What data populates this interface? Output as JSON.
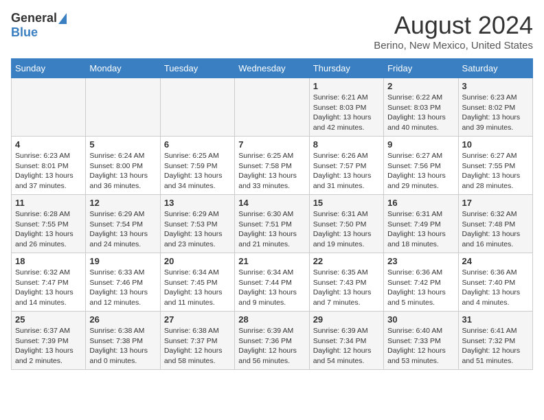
{
  "header": {
    "logo_general": "General",
    "logo_blue": "Blue",
    "month_year": "August 2024",
    "location": "Berino, New Mexico, United States"
  },
  "calendar": {
    "days_of_week": [
      "Sunday",
      "Monday",
      "Tuesday",
      "Wednesday",
      "Thursday",
      "Friday",
      "Saturday"
    ],
    "weeks": [
      [
        {
          "day": "",
          "info": ""
        },
        {
          "day": "",
          "info": ""
        },
        {
          "day": "",
          "info": ""
        },
        {
          "day": "",
          "info": ""
        },
        {
          "day": "1",
          "info": "Sunrise: 6:21 AM\nSunset: 8:03 PM\nDaylight: 13 hours\nand 42 minutes."
        },
        {
          "day": "2",
          "info": "Sunrise: 6:22 AM\nSunset: 8:03 PM\nDaylight: 13 hours\nand 40 minutes."
        },
        {
          "day": "3",
          "info": "Sunrise: 6:23 AM\nSunset: 8:02 PM\nDaylight: 13 hours\nand 39 minutes."
        }
      ],
      [
        {
          "day": "4",
          "info": "Sunrise: 6:23 AM\nSunset: 8:01 PM\nDaylight: 13 hours\nand 37 minutes."
        },
        {
          "day": "5",
          "info": "Sunrise: 6:24 AM\nSunset: 8:00 PM\nDaylight: 13 hours\nand 36 minutes."
        },
        {
          "day": "6",
          "info": "Sunrise: 6:25 AM\nSunset: 7:59 PM\nDaylight: 13 hours\nand 34 minutes."
        },
        {
          "day": "7",
          "info": "Sunrise: 6:25 AM\nSunset: 7:58 PM\nDaylight: 13 hours\nand 33 minutes."
        },
        {
          "day": "8",
          "info": "Sunrise: 6:26 AM\nSunset: 7:57 PM\nDaylight: 13 hours\nand 31 minutes."
        },
        {
          "day": "9",
          "info": "Sunrise: 6:27 AM\nSunset: 7:56 PM\nDaylight: 13 hours\nand 29 minutes."
        },
        {
          "day": "10",
          "info": "Sunrise: 6:27 AM\nSunset: 7:55 PM\nDaylight: 13 hours\nand 28 minutes."
        }
      ],
      [
        {
          "day": "11",
          "info": "Sunrise: 6:28 AM\nSunset: 7:55 PM\nDaylight: 13 hours\nand 26 minutes."
        },
        {
          "day": "12",
          "info": "Sunrise: 6:29 AM\nSunset: 7:54 PM\nDaylight: 13 hours\nand 24 minutes."
        },
        {
          "day": "13",
          "info": "Sunrise: 6:29 AM\nSunset: 7:53 PM\nDaylight: 13 hours\nand 23 minutes."
        },
        {
          "day": "14",
          "info": "Sunrise: 6:30 AM\nSunset: 7:51 PM\nDaylight: 13 hours\nand 21 minutes."
        },
        {
          "day": "15",
          "info": "Sunrise: 6:31 AM\nSunset: 7:50 PM\nDaylight: 13 hours\nand 19 minutes."
        },
        {
          "day": "16",
          "info": "Sunrise: 6:31 AM\nSunset: 7:49 PM\nDaylight: 13 hours\nand 18 minutes."
        },
        {
          "day": "17",
          "info": "Sunrise: 6:32 AM\nSunset: 7:48 PM\nDaylight: 13 hours\nand 16 minutes."
        }
      ],
      [
        {
          "day": "18",
          "info": "Sunrise: 6:32 AM\nSunset: 7:47 PM\nDaylight: 13 hours\nand 14 minutes."
        },
        {
          "day": "19",
          "info": "Sunrise: 6:33 AM\nSunset: 7:46 PM\nDaylight: 13 hours\nand 12 minutes."
        },
        {
          "day": "20",
          "info": "Sunrise: 6:34 AM\nSunset: 7:45 PM\nDaylight: 13 hours\nand 11 minutes."
        },
        {
          "day": "21",
          "info": "Sunrise: 6:34 AM\nSunset: 7:44 PM\nDaylight: 13 hours\nand 9 minutes."
        },
        {
          "day": "22",
          "info": "Sunrise: 6:35 AM\nSunset: 7:43 PM\nDaylight: 13 hours\nand 7 minutes."
        },
        {
          "day": "23",
          "info": "Sunrise: 6:36 AM\nSunset: 7:42 PM\nDaylight: 13 hours\nand 5 minutes."
        },
        {
          "day": "24",
          "info": "Sunrise: 6:36 AM\nSunset: 7:40 PM\nDaylight: 13 hours\nand 4 minutes."
        }
      ],
      [
        {
          "day": "25",
          "info": "Sunrise: 6:37 AM\nSunset: 7:39 PM\nDaylight: 13 hours\nand 2 minutes."
        },
        {
          "day": "26",
          "info": "Sunrise: 6:38 AM\nSunset: 7:38 PM\nDaylight: 13 hours\nand 0 minutes."
        },
        {
          "day": "27",
          "info": "Sunrise: 6:38 AM\nSunset: 7:37 PM\nDaylight: 12 hours\nand 58 minutes."
        },
        {
          "day": "28",
          "info": "Sunrise: 6:39 AM\nSunset: 7:36 PM\nDaylight: 12 hours\nand 56 minutes."
        },
        {
          "day": "29",
          "info": "Sunrise: 6:39 AM\nSunset: 7:34 PM\nDaylight: 12 hours\nand 54 minutes."
        },
        {
          "day": "30",
          "info": "Sunrise: 6:40 AM\nSunset: 7:33 PM\nDaylight: 12 hours\nand 53 minutes."
        },
        {
          "day": "31",
          "info": "Sunrise: 6:41 AM\nSunset: 7:32 PM\nDaylight: 12 hours\nand 51 minutes."
        }
      ]
    ]
  }
}
